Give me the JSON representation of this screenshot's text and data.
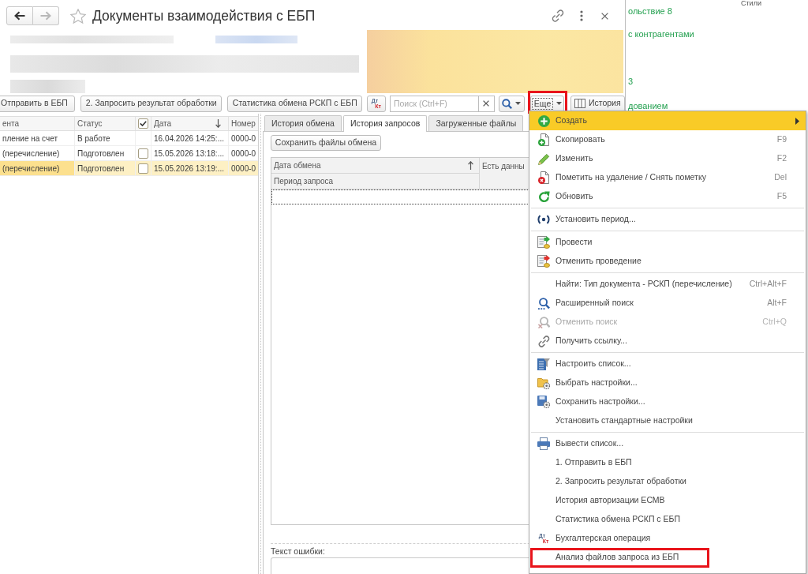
{
  "window": {
    "title": "Документы взаимодействия с ЕБП",
    "favorite": false,
    "back_enabled": true,
    "forward_enabled": false
  },
  "toolbar": {
    "buttons": [
      {
        "label": "Отправить в ЕБП"
      },
      {
        "label": "2. Запросить результат обработки"
      },
      {
        "label": "Статистика обмена РСКП с ЕБП"
      }
    ],
    "posting_button": {
      "debit": "Дт",
      "credit": "Кт"
    },
    "search": {
      "placeholder": "Поиск (Ctrl+F)"
    },
    "more_button": {
      "label": "Еще",
      "annotated": true
    },
    "history_button": {
      "label": "История"
    }
  },
  "documents_table": {
    "columns": [
      {
        "kind": "text",
        "label": "ента",
        "sorted": false
      },
      {
        "kind": "text",
        "label": "Статус",
        "sorted": false
      },
      {
        "kind": "checkbox",
        "checked": true
      },
      {
        "kind": "text",
        "label": "Дата",
        "sorted": true,
        "descending": true
      },
      {
        "kind": "text",
        "label": "Номер",
        "sorted": false
      }
    ],
    "rows": [
      {
        "kind": "plain",
        "document": "пление на счет",
        "status": "В работе",
        "date": "16.04.2026 14:25:...",
        "number": "0000-0",
        "selected": false
      },
      {
        "kind": "checkable",
        "document": "(перечисление)",
        "status": "Подготовлен",
        "checked": false,
        "date": "15.05.2026 13:18:...",
        "number": "0000-0",
        "selected": false
      },
      {
        "kind": "checkable",
        "document": "(перечисление)",
        "status": "Подготовлен",
        "checked": false,
        "date": "15.05.2026 13:19:...",
        "number": "0000-0",
        "selected": true
      }
    ]
  },
  "details": {
    "tabs": [
      {
        "label": "История обмена",
        "selected": false
      },
      {
        "label": "История запросов",
        "selected": true
      },
      {
        "label": "Загруженные файлы",
        "selected": false
      }
    ],
    "save_button": {
      "label": "Сохранить файлы обмена"
    },
    "exchange_table": {
      "columns": [
        {
          "label": "Дата обмена",
          "sorted": true,
          "descending": false,
          "sub_label": "Период запроса"
        },
        {
          "label": "Есть данны",
          "sorted": false
        }
      ]
    },
    "error_field": {
      "label": "Текст ошибки:"
    }
  },
  "background": {
    "column_header": "Стили",
    "links": [
      "ольствие 8",
      "с контрагентами",
      "3",
      "дованием"
    ]
  },
  "context_menu": {
    "items": [
      {
        "kind": "item",
        "label": "Создать",
        "selected": true,
        "disabled": false,
        "submenu": true,
        "annotated": false
      },
      {
        "kind": "item",
        "label": "Скопировать",
        "shortcut": "F9",
        "selected": false,
        "disabled": false,
        "submenu": false,
        "annotated": false
      },
      {
        "kind": "item",
        "label": "Изменить",
        "shortcut": "F2",
        "selected": false,
        "disabled": false,
        "submenu": false,
        "annotated": false
      },
      {
        "kind": "item",
        "label": "Пометить на удаление / Снять пометку",
        "shortcut": "Del",
        "selected": false,
        "disabled": false,
        "submenu": false,
        "annotated": false
      },
      {
        "kind": "item",
        "label": "Обновить",
        "shortcut": "F5",
        "selected": false,
        "disabled": false,
        "submenu": false,
        "annotated": false
      },
      {
        "kind": "separator"
      },
      {
        "kind": "item",
        "label": "Установить период...",
        "selected": false,
        "disabled": false,
        "submenu": false,
        "annotated": false
      },
      {
        "kind": "separator"
      },
      {
        "kind": "item",
        "label": "Провести",
        "selected": false,
        "disabled": false,
        "submenu": false,
        "annotated": false
      },
      {
        "kind": "item",
        "label": "Отменить проведение",
        "selected": false,
        "disabled": false,
        "submenu": false,
        "annotated": false
      },
      {
        "kind": "separator"
      },
      {
        "kind": "item",
        "label": "Найти: Тип документа - РСКП (перечисление)",
        "shortcut": "Ctrl+Alt+F",
        "selected": false,
        "disabled": false,
        "submenu": false,
        "annotated": false
      },
      {
        "kind": "item",
        "label": "Расширенный поиск",
        "shortcut": "Alt+F",
        "selected": false,
        "disabled": false,
        "submenu": false,
        "annotated": false
      },
      {
        "kind": "item",
        "label": "Отменить поиск",
        "shortcut": "Ctrl+Q",
        "selected": false,
        "disabled": true,
        "submenu": false,
        "annotated": false
      },
      {
        "kind": "item",
        "label": "Получить ссылку...",
        "selected": false,
        "disabled": false,
        "submenu": false,
        "annotated": false
      },
      {
        "kind": "separator"
      },
      {
        "kind": "item",
        "label": "Настроить список...",
        "selected": false,
        "disabled": false,
        "submenu": false,
        "annotated": false
      },
      {
        "kind": "item",
        "label": "Выбрать настройки...",
        "selected": false,
        "disabled": false,
        "submenu": false,
        "annotated": false
      },
      {
        "kind": "item",
        "label": "Сохранить настройки...",
        "selected": false,
        "disabled": false,
        "submenu": false,
        "annotated": false
      },
      {
        "kind": "item",
        "label": "Установить стандартные настройки",
        "selected": false,
        "disabled": false,
        "submenu": false,
        "annotated": false
      },
      {
        "kind": "separator"
      },
      {
        "kind": "item",
        "label": "Вывести список...",
        "selected": false,
        "disabled": false,
        "submenu": false,
        "annotated": false
      },
      {
        "kind": "item",
        "label": "1. Отправить в ЕБП",
        "selected": false,
        "disabled": false,
        "submenu": false,
        "annotated": false
      },
      {
        "kind": "item",
        "label": "2. Запросить результат обработки",
        "selected": false,
        "disabled": false,
        "submenu": false,
        "annotated": false
      },
      {
        "kind": "item",
        "label": "История авторизации ЕСМВ",
        "selected": false,
        "disabled": false,
        "submenu": false,
        "annotated": false
      },
      {
        "kind": "item",
        "label": "Статистика обмена РСКП с ЕБП",
        "selected": false,
        "disabled": false,
        "submenu": false,
        "annotated": false
      },
      {
        "kind": "item",
        "label": "Бухгалтерская операция",
        "badge": {
          "debit": "Дт",
          "credit": "Кт"
        },
        "selected": false,
        "disabled": false,
        "submenu": false,
        "annotated": false
      },
      {
        "kind": "item",
        "label": "Анализ файлов запроса из ЕБП",
        "selected": false,
        "disabled": false,
        "submenu": false,
        "annotated": true
      }
    ]
  }
}
